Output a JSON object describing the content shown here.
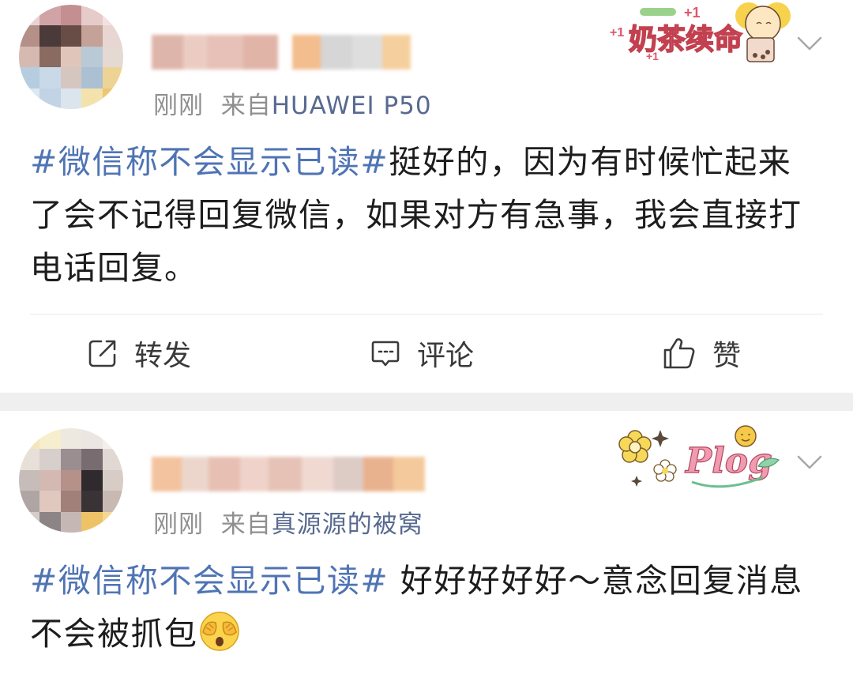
{
  "posts": [
    {
      "meta_time": "刚刚",
      "meta_from": "来自",
      "meta_source": "HUAWEI P50",
      "topic": "#微信称不会显示已读#",
      "body": "挺好的，因为有时候忙起来了会不记得回复微信，如果对方有急事，我会直接打电话回复。",
      "deco_text": "奶茶续命",
      "deco_plus": "+1",
      "deco_icon": "milk-tea-sticker",
      "actions": {
        "share": "转发",
        "comment": "评论",
        "like": "赞"
      }
    },
    {
      "meta_time": "刚刚",
      "meta_from": "来自",
      "meta_source": "真源源的被窝",
      "topic": "#微信称不会显示已读#",
      "body": " 好好好好好～意念回复消息不会被抓包",
      "deco_text": "Plog",
      "deco_icon": "flower-plog-sticker",
      "emoji": "face-covering-eyes-emoji"
    }
  ],
  "colors": {
    "topic": "#4f74b4",
    "source": "#586a90",
    "meta": "#8f8f8f",
    "separator": "#efefef"
  }
}
